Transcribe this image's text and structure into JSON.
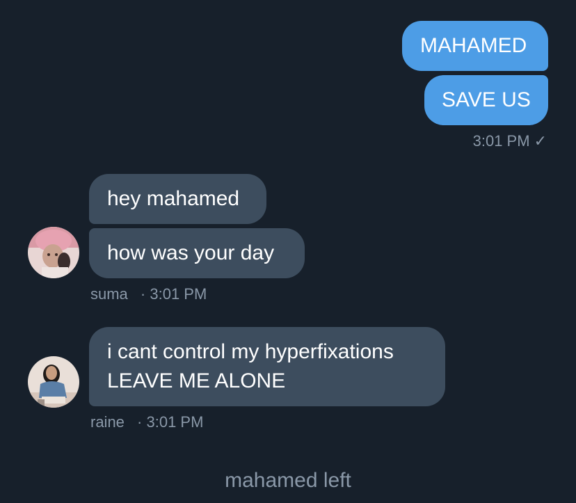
{
  "outgoing": {
    "messages": [
      "MAHAMED",
      "SAVE US"
    ],
    "time": "3:01 PM",
    "status_glyph": "✓"
  },
  "incoming": [
    {
      "sender": "suma",
      "time": "3:01 PM",
      "messages": [
        "hey mahamed",
        "how was your day"
      ]
    },
    {
      "sender": "raine",
      "time": "3:01 PM",
      "messages": [
        "i cant control my hyperfixations",
        "LEAVE ME ALONE"
      ]
    }
  ],
  "system_message": "mahamed left",
  "meta_separator": "·",
  "colors": {
    "background": "#17202b",
    "outgoing_bubble": "#4d9de6",
    "incoming_bubble": "#3d4d5e",
    "meta_text": "#8a98a8"
  }
}
